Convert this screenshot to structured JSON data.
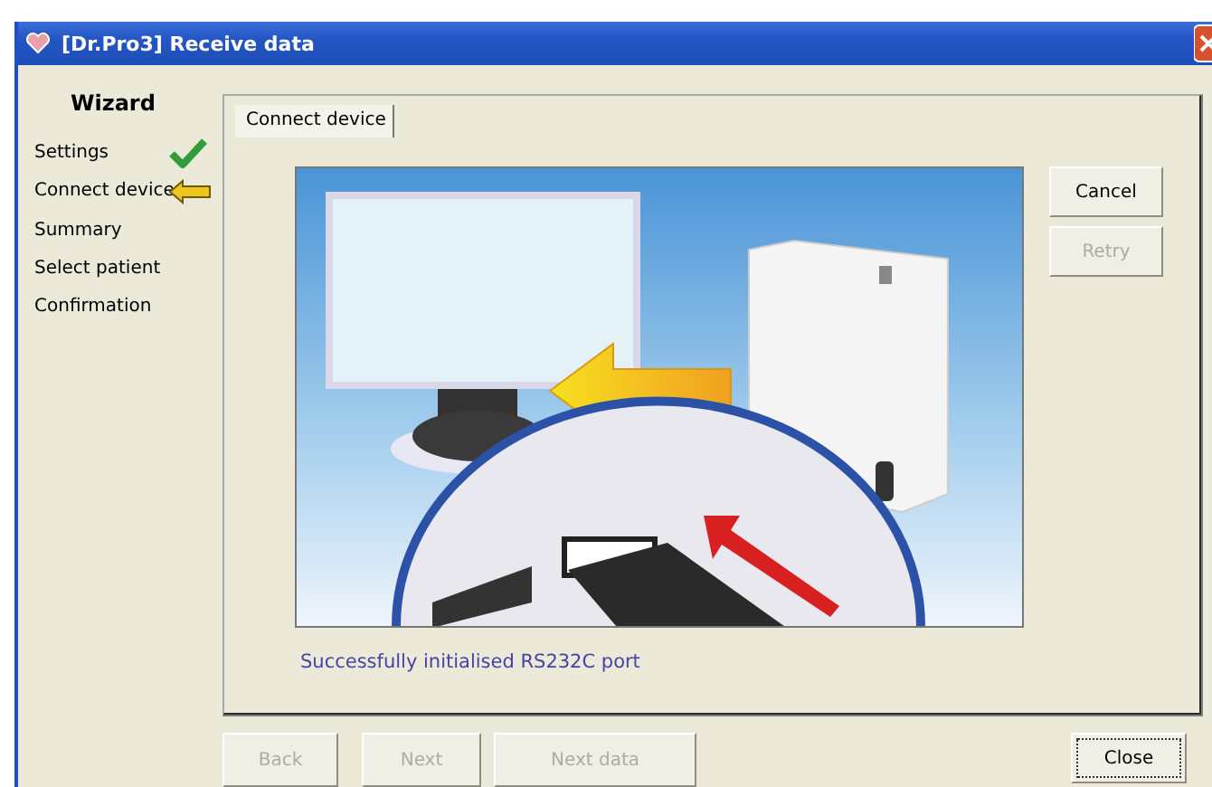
{
  "window": {
    "title": "[Dr.Pro3] Receive data"
  },
  "wizard": {
    "heading": "Wizard",
    "steps": [
      {
        "label": "Settings",
        "kind": "done"
      },
      {
        "label": "Connect device",
        "kind": "current"
      },
      {
        "label": "Summary",
        "kind": "pending"
      },
      {
        "label": "Select patient",
        "kind": "pending"
      },
      {
        "label": "Confirmation",
        "kind": "pending"
      }
    ]
  },
  "tabs": [
    {
      "label": "Connect device",
      "selected": true
    }
  ],
  "side_buttons": [
    {
      "label": "Cancel",
      "disabled": false
    },
    {
      "label": "Retry",
      "disabled": true
    }
  ],
  "status_message": "Successfully initialised RS232C port",
  "nav_buttons": [
    {
      "label": "Back",
      "disabled": true
    },
    {
      "label": "Next",
      "disabled": true
    },
    {
      "label": "Next data",
      "disabled": true
    }
  ],
  "close_button": {
    "label": "Close",
    "disabled": false,
    "focused": true
  }
}
